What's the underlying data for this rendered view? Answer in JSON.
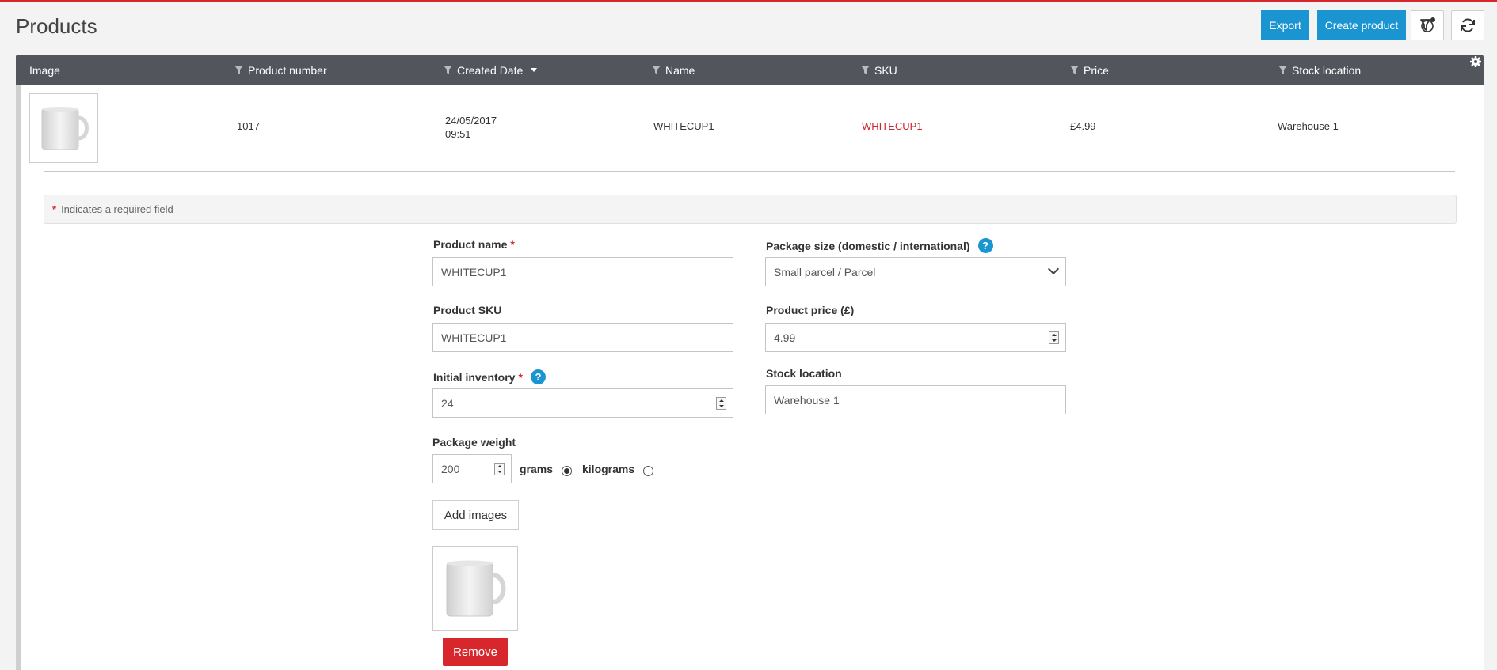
{
  "page": {
    "title": "Products"
  },
  "header": {
    "export_label": "Export",
    "create_label": "Create product",
    "filter_icon": "filter-settings-icon",
    "refresh_icon": "refresh-icon"
  },
  "colors": {
    "accent": "#1a95d2",
    "danger": "#d8272c",
    "table_header": "#52555b"
  },
  "table": {
    "columns": [
      "Image",
      "Product number",
      "Created Date",
      "Name",
      "SKU",
      "Price",
      "Stock location"
    ],
    "rows": [
      {
        "product_number": "1017",
        "created_date": "24/05/2017",
        "created_time": "09:51",
        "name": "WHITECUP1",
        "sku": "WHITECUP1",
        "price": "£4.99",
        "stock_location": "Warehouse 1"
      }
    ]
  },
  "form": {
    "required_note": "Indicates a required field",
    "required_mark": "*",
    "help_mark": "?",
    "product_name": {
      "label": "Product name",
      "value": "WHITECUP1"
    },
    "package_size": {
      "label": "Package size (domestic / international)",
      "value": "Small parcel / Parcel"
    },
    "product_sku": {
      "label": "Product SKU",
      "value": "WHITECUP1"
    },
    "product_price": {
      "label": "Product price (£)",
      "value": "4.99"
    },
    "initial_inventory": {
      "label": "Initial inventory",
      "value": "24"
    },
    "stock_location": {
      "label": "Stock location",
      "value": "Warehouse 1"
    },
    "package_weight": {
      "label": "Package weight",
      "value": "200",
      "unit_grams": "grams",
      "unit_kilograms": "kilograms",
      "selected_unit": "grams"
    },
    "add_images_label": "Add images",
    "remove_label": "Remove"
  }
}
